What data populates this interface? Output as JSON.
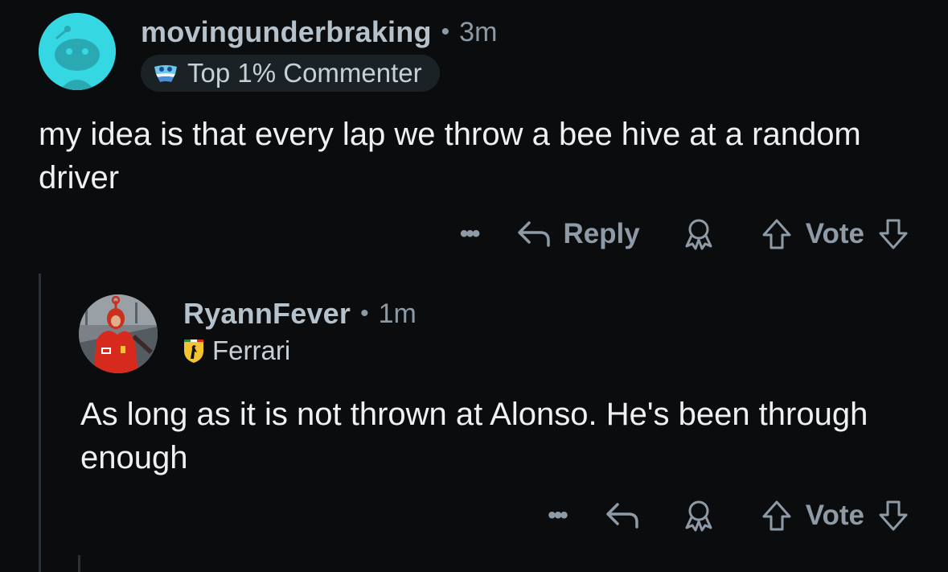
{
  "comments": [
    {
      "username": "movingunderbraking",
      "separator": "•",
      "time": "3m",
      "flair": "Top 1% Commenter",
      "body": "my idea is that every lap we throw a bee hive at a random driver",
      "actions": {
        "more": "•••",
        "reply_label": "Reply",
        "vote_label": "Vote"
      }
    },
    {
      "username": "RyannFever",
      "separator": "•",
      "time": "1m",
      "flair": "Ferrari",
      "body": "As long as it is not thrown at Alonso. He's been through enough",
      "actions": {
        "more": "•••",
        "vote_label": "Vote"
      }
    }
  ],
  "icons": {
    "reply": "reply-arrow-icon",
    "award": "award-icon",
    "upvote": "upvote-arrow-icon",
    "downvote": "downvote-arrow-icon",
    "flair_top": "top-commenter-badge-icon",
    "flair_ferrari": "ferrari-shield-icon"
  },
  "colors": {
    "background": "#0b0c0e",
    "avatar_teal": "#35d7e3",
    "meta_text": "#8c9aa5",
    "body_text": "#eef1f3",
    "ferrari_yellow": "#f4c430"
  }
}
